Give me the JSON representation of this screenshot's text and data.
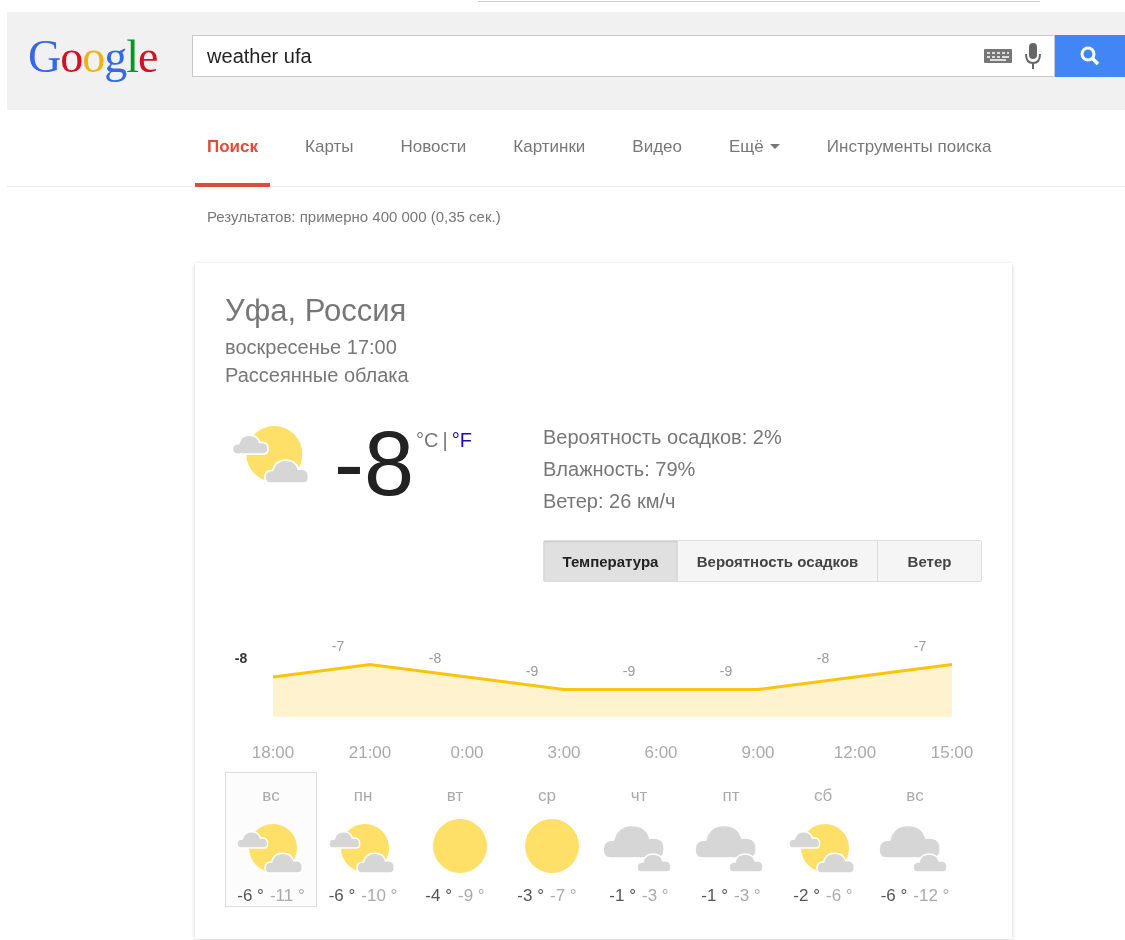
{
  "header": {
    "logo": "Google",
    "search": {
      "value": "weather ufa"
    }
  },
  "nav": {
    "items": [
      {
        "label": "Поиск",
        "selected": true,
        "kind": "link"
      },
      {
        "label": "Карты",
        "selected": false,
        "kind": "link"
      },
      {
        "label": "Новости",
        "selected": false,
        "kind": "link"
      },
      {
        "label": "Картинки",
        "selected": false,
        "kind": "link"
      },
      {
        "label": "Видео",
        "selected": false,
        "kind": "link"
      },
      {
        "label": "Ещё",
        "selected": false,
        "kind": "menu"
      },
      {
        "label": "Инструменты поиска",
        "selected": false,
        "kind": "link"
      }
    ]
  },
  "result_stats": "Результатов: примерно 400 000 (0,35 сек.)",
  "weather": {
    "location": "Уфа, Россия",
    "time": "воскресенье 17:00",
    "condition": "Рассеянные облака",
    "current": {
      "kind": "partly-cloudy",
      "temperature": "-8"
    },
    "units": [
      {
        "label": "°C",
        "selected": true
      },
      {
        "label": "°F",
        "selected": false
      }
    ],
    "unit_separator": "|",
    "details": [
      "Вероятность осадков: 2%",
      "Влажность: 79%",
      "Ветер: 26 км/ч"
    ],
    "chart_tabs": [
      {
        "label": "Температура",
        "selected": true
      },
      {
        "label": "Вероятность осадков",
        "selected": false
      },
      {
        "label": "Ветер",
        "selected": false
      }
    ],
    "chart": {
      "chart_data": {
        "type": "area",
        "categories": [
          "18:00",
          "21:00",
          "0:00",
          "3:00",
          "6:00",
          "9:00",
          "12:00",
          "15:00"
        ],
        "series": [
          {
            "color": "#fbc40b",
            "values": [
              -8,
              -7,
              -8,
              -9,
              -9,
              -9,
              -8,
              -7
            ]
          }
        ],
        "data_labels": true
      }
    },
    "forecast": [
      {
        "day": "вс",
        "kind": "partly-cloudy",
        "high": "-6 °",
        "low": "-11 °",
        "selected": true
      },
      {
        "day": "пн",
        "kind": "partly-cloudy",
        "high": "-6 °",
        "low": "-10 °",
        "selected": false
      },
      {
        "day": "вт",
        "kind": "sunny",
        "high": "-4 °",
        "low": "-9 °",
        "selected": false
      },
      {
        "day": "ср",
        "kind": "sunny",
        "high": "-3 °",
        "low": "-7 °",
        "selected": false
      },
      {
        "day": "чт",
        "kind": "cloudy",
        "high": "-1 °",
        "low": "-3 °",
        "selected": false
      },
      {
        "day": "пт",
        "kind": "cloudy",
        "high": "-1 °",
        "low": "-3 °",
        "selected": false
      },
      {
        "day": "сб",
        "kind": "partly-cloudy",
        "high": "-2 °",
        "low": "-6 °",
        "selected": false
      },
      {
        "day": "вс",
        "kind": "cloudy",
        "high": "-6 °",
        "low": "-12 °",
        "selected": false
      }
    ]
  }
}
